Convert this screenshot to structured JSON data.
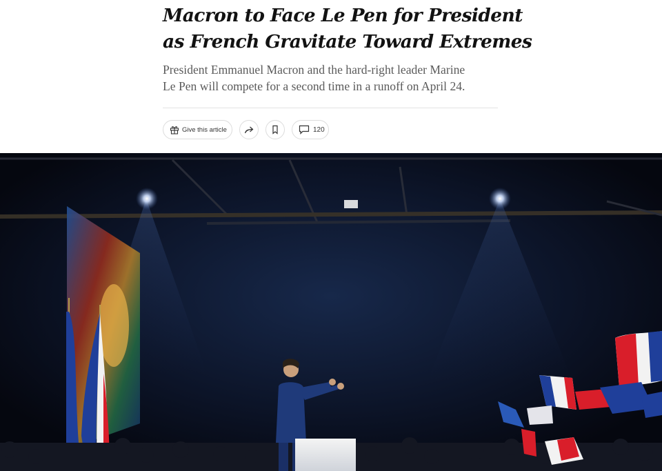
{
  "article": {
    "headline_line1": "Macron to Face Le Pen for President",
    "headline_line2": "as French Gravitate Toward Extremes",
    "summary_line1": "President Emmanuel Macron and the hard-right leader Marine",
    "summary_line2": "Le Pen will compete for a second time in a runoff on April 24."
  },
  "share_bar": {
    "gift_label": "Give this article",
    "comment_count": "120",
    "icons": [
      "gift-icon",
      "share-icon",
      "bookmark-icon",
      "comment-icon"
    ]
  },
  "colors": {
    "headline": "#121212",
    "summary": "#5a5a5a",
    "stage_dark": "#080b16",
    "flag_blue": "#1f3f9a",
    "flag_red": "#d91e2a"
  }
}
